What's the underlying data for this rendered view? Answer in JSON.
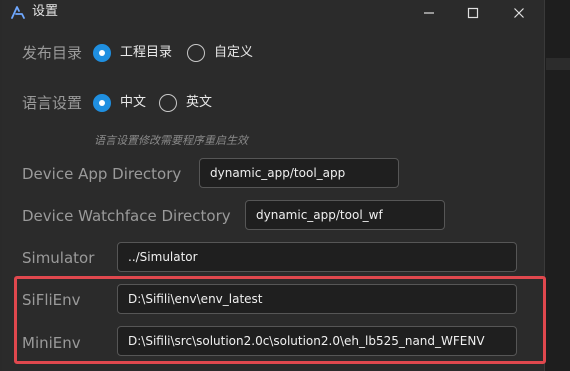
{
  "window": {
    "title": "设置",
    "controls": {
      "minimize": "minimize",
      "maximize": "maximize",
      "close": "close"
    }
  },
  "publish": {
    "label": "发布目录",
    "options": [
      "工程目录",
      "自定义"
    ],
    "selected": "工程目录"
  },
  "language": {
    "label": "语言设置",
    "options": [
      "中文",
      "英文"
    ],
    "selected": "中文",
    "hint": "语言设置修改需要程序重启生效"
  },
  "fields": [
    {
      "label": "Device App Directory",
      "value": "dynamic_app/tool_app"
    },
    {
      "label": "Device Watchface Directory",
      "value": "dynamic_app/tool_wf"
    },
    {
      "label": "Simulator",
      "value": "../Simulator"
    },
    {
      "label": "SiFliEnv",
      "value": "D:\\Sifili\\env\\env_latest"
    },
    {
      "label": "MiniEnv",
      "value": "D:\\Sifili\\src\\solution2.0c\\solution2.0\\eh_lb525_nand_WFENV"
    }
  ],
  "colors": {
    "accent": "#1f8fe0",
    "highlight_border": "#e0484e"
  },
  "icons": [
    "app-logo-icon",
    "minimize-icon",
    "maximize-icon",
    "close-icon"
  ]
}
